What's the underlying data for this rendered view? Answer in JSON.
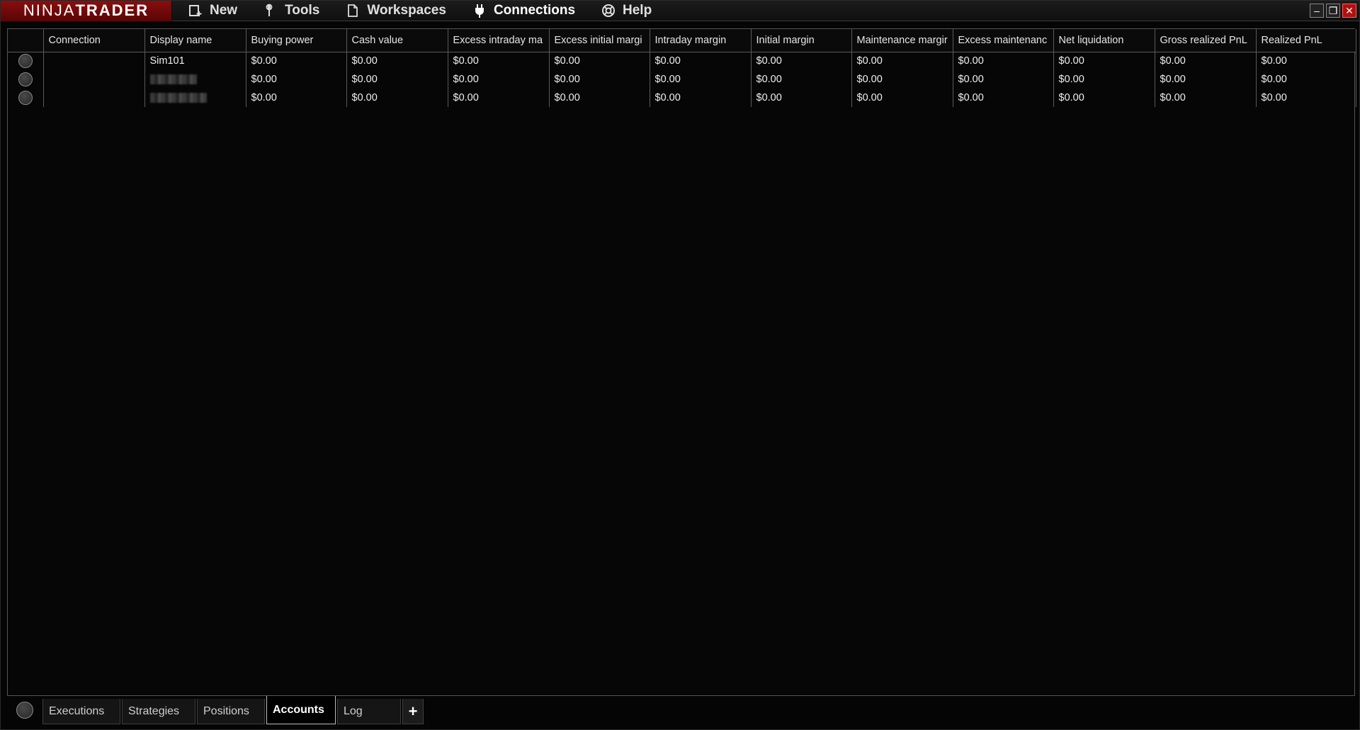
{
  "app": {
    "logo_left": "NINJA",
    "logo_right": "TRADER"
  },
  "menu": {
    "items": [
      {
        "label": "New",
        "icon": "new-window-icon"
      },
      {
        "label": "Tools",
        "icon": "wrench-icon"
      },
      {
        "label": "Workspaces",
        "icon": "document-icon"
      },
      {
        "label": "Connections",
        "icon": "plug-icon"
      },
      {
        "label": "Help",
        "icon": "lifebuoy-icon"
      }
    ]
  },
  "window_controls": {
    "minimize": "–",
    "restore": "❐",
    "close": "✕"
  },
  "grid": {
    "columns": [
      "",
      "Connection",
      "Display name",
      "Buying power",
      "Cash value",
      "Excess intraday ma",
      "Excess initial margi",
      "Intraday margin",
      "Initial margin",
      "Maintenance margir",
      "Excess maintenanc",
      "Net liquidation",
      "Gross realized PnL",
      "Realized PnL"
    ],
    "rows": [
      {
        "connection": "",
        "display_name": "Sim101",
        "values": [
          "$0.00",
          "$0.00",
          "$0.00",
          "$0.00",
          "$0.00",
          "$0.00",
          "$0.00",
          "$0.00",
          "$0.00",
          "$0.00",
          "$0.00"
        ]
      },
      {
        "connection": "",
        "display_name": "",
        "values": [
          "$0.00",
          "$0.00",
          "$0.00",
          "$0.00",
          "$0.00",
          "$0.00",
          "$0.00",
          "$0.00",
          "$0.00",
          "$0.00",
          "$0.00"
        ]
      },
      {
        "connection": "",
        "display_name": "",
        "values": [
          "$0.00",
          "$0.00",
          "$0.00",
          "$0.00",
          "$0.00",
          "$0.00",
          "$0.00",
          "$0.00",
          "$0.00",
          "$0.00",
          "$0.00"
        ]
      }
    ]
  },
  "tabs": {
    "items": [
      "Executions",
      "Strategies",
      "Positions",
      "Accounts",
      "Log"
    ],
    "active": "Accounts",
    "add_label": "+"
  },
  "colors": {
    "logo_bg": "#7a0a0a",
    "background": "#050505",
    "grid_line": "#5a5a5a"
  }
}
